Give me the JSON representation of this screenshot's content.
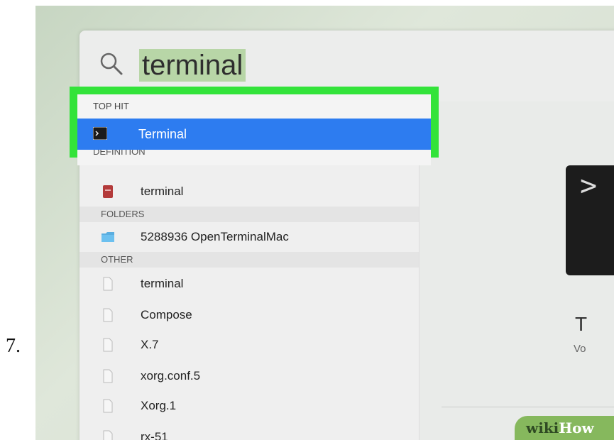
{
  "step_number": "7.",
  "search": {
    "query": "terminal"
  },
  "top_hit": {
    "header": "TOP HIT",
    "item": "Terminal",
    "next_header_clipped": "DEFINITION"
  },
  "results": [
    {
      "type": "item",
      "label": "terminal",
      "icon": "dictionary-icon"
    },
    {
      "type": "header",
      "label": "FOLDERS"
    },
    {
      "type": "item",
      "label": "5288936 OpenTerminalMac",
      "icon": "folder-icon"
    },
    {
      "type": "header",
      "label": "OTHER"
    },
    {
      "type": "item",
      "label": "terminal",
      "icon": "document-icon"
    },
    {
      "type": "item",
      "label": "Compose",
      "icon": "document-icon"
    },
    {
      "type": "item",
      "label": "X.7",
      "icon": "document-icon"
    },
    {
      "type": "item",
      "label": "xorg.conf.5",
      "icon": "document-icon"
    },
    {
      "type": "item",
      "label": "Xorg.1",
      "icon": "document-icon"
    },
    {
      "type": "item",
      "label": "rx-51",
      "icon": "document-icon"
    }
  ],
  "preview": {
    "icon_glyph": ">",
    "title": "T",
    "subtitle": "Vo"
  },
  "watermark": {
    "part1": "wiki",
    "part2": "How"
  },
  "colors": {
    "highlight_green": "#33e33a",
    "selection_blue": "#2d7cf0",
    "query_highlight": "#b8d6a7"
  }
}
